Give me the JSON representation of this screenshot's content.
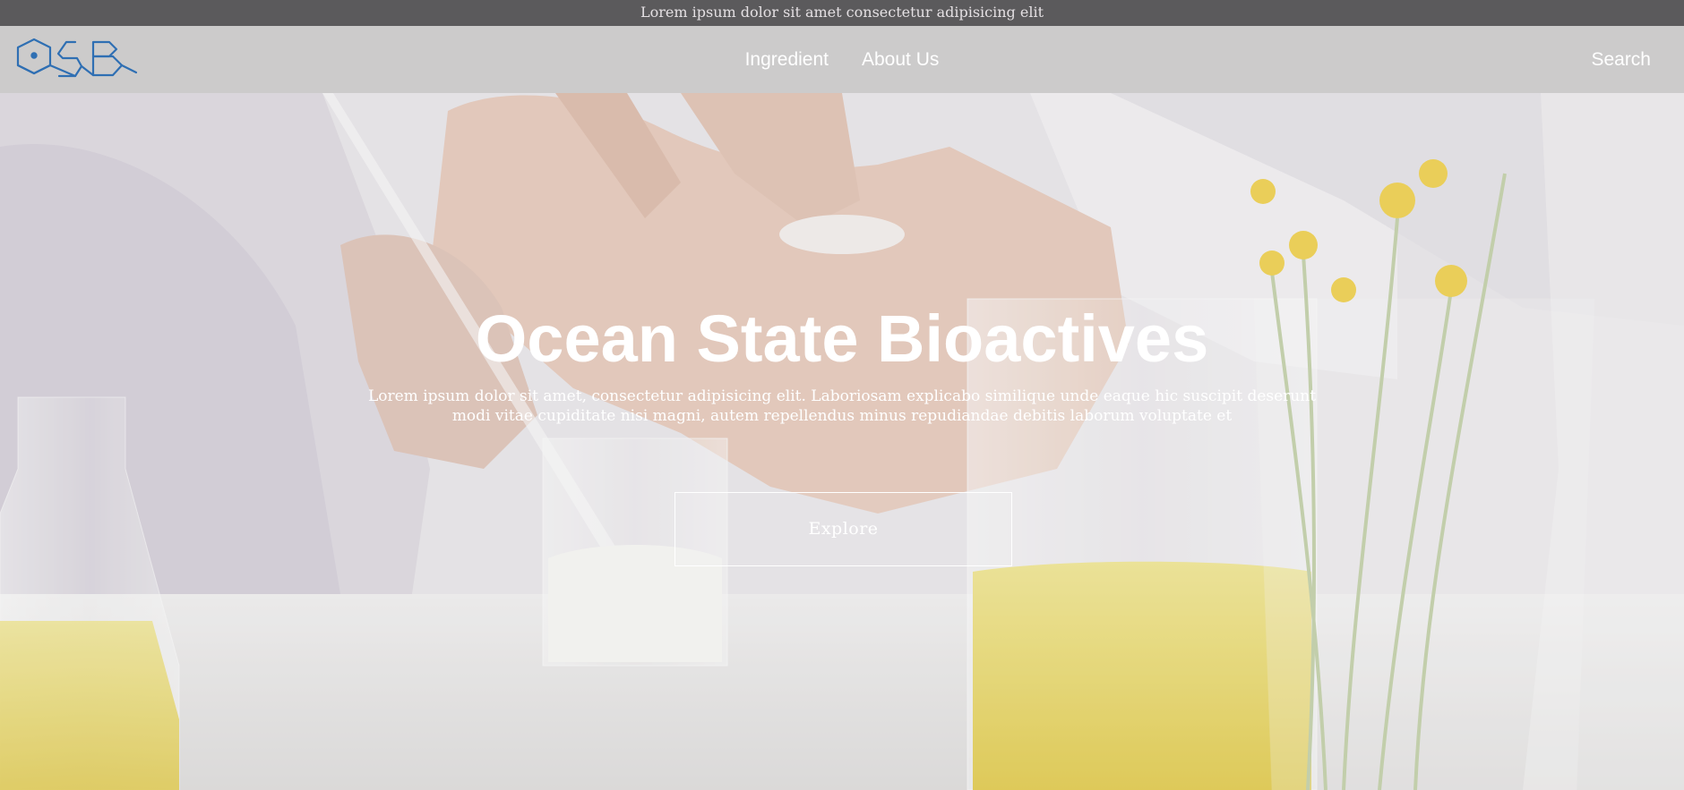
{
  "announcement": {
    "text": "Lorem ipsum dolor sit amet consectetur adipisicing elit"
  },
  "nav": {
    "logo_text": "OSB",
    "links": [
      "Ingredient",
      "About Us"
    ],
    "search_label": "Search"
  },
  "hero": {
    "title": "Ocean State Bioactives",
    "description": "Lorem ipsum dolor sit amet, consectetur adipisicing elit. Laboriosam explicabo similique unde eaque hic suscipit deserunt modi vitae cupiditate nisi magni, autem repellendus minus repudiandae debitis laborum voluptate et",
    "cta_label": "Explore"
  },
  "colors": {
    "announcement_bg": "#5b5a5c",
    "navbar_bg": "#cccbcb",
    "logo": "#2f6fb3",
    "text_on_image": "#ffffff"
  }
}
